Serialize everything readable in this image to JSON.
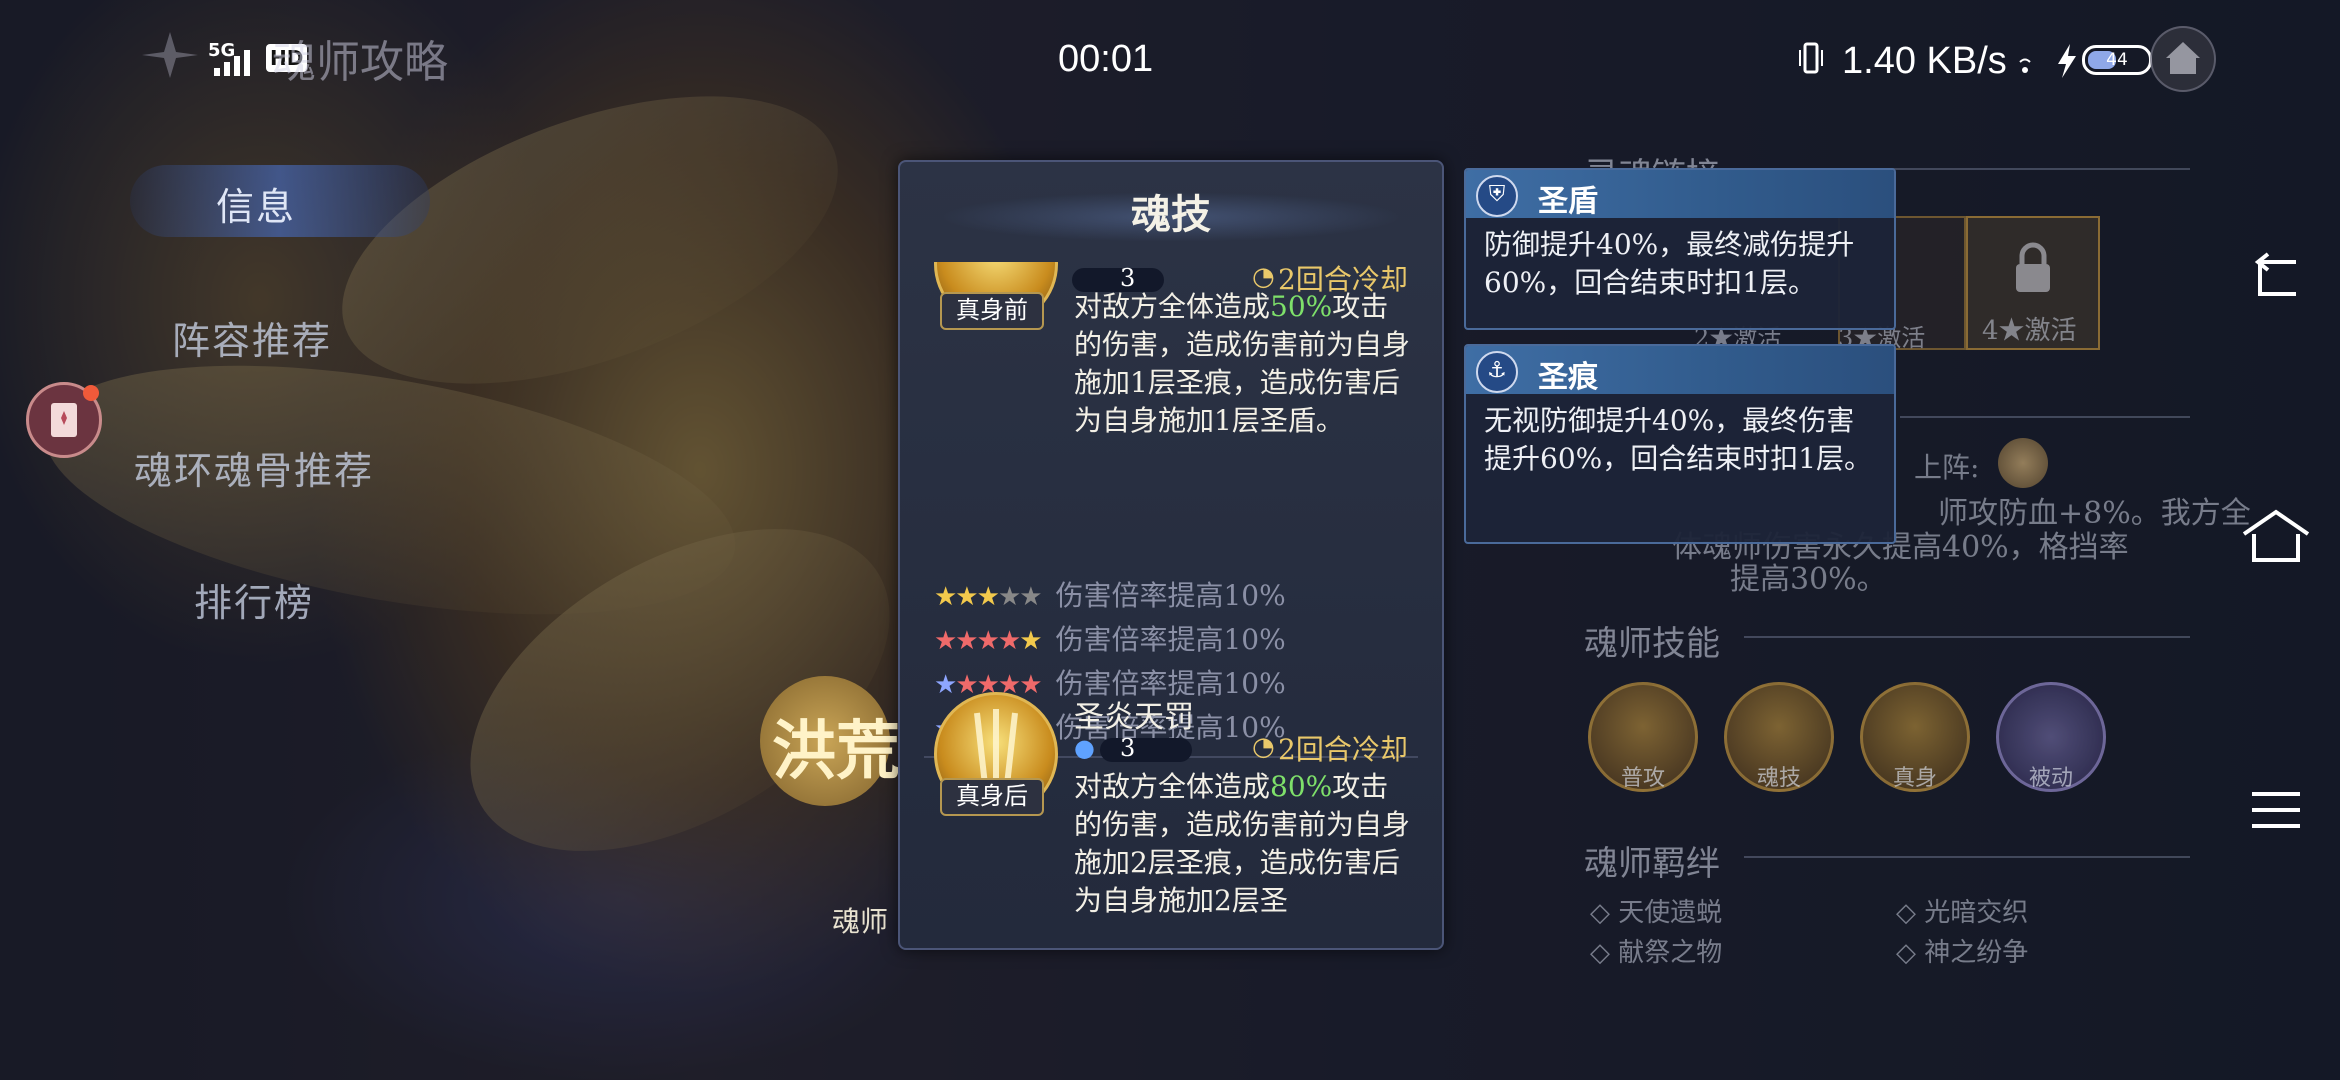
{
  "status_bar": {
    "network": "5G",
    "hd_badge": "HD",
    "time": "00:01",
    "speed": "1.40 KB/s",
    "battery": "44"
  },
  "header": {
    "title": "魂师攻略"
  },
  "left_menu": {
    "items": [
      "信息",
      "阵容推荐",
      "魂环魂骨推荐",
      "排行榜"
    ],
    "active_index": 0
  },
  "hero_banner": {
    "name_partial": "洪荒",
    "caption_partial": "魂师"
  },
  "soul_skill_panel": {
    "title": "魂技",
    "skill1": {
      "tag": "真身前",
      "cost": "3",
      "cooldown": "2回合冷却",
      "desc_before": "对敌方全体造成",
      "desc_percent": "50%",
      "desc_after": "攻击的伤害，造成伤害前为自身施加1层圣痕，造成伤害后为自身施加1层圣盾。"
    },
    "upgrades": [
      {
        "stars": "★★★★★",
        "text": "伤害倍率提高10%"
      },
      {
        "stars": "★★★★★",
        "text": "伤害倍率提高10%"
      },
      {
        "stars": "★★★★★",
        "text": "伤害倍率提高10%"
      },
      {
        "stars": "★★★★★",
        "text": "伤害倍率提高10%"
      }
    ],
    "skill2": {
      "name": "圣炎天罚",
      "tag": "真身后",
      "cost": "3",
      "cooldown": "2回合冷却",
      "desc_before": "对敌方全体造成",
      "desc_percent": "80%",
      "desc_after": "攻击的伤害，造成伤害前为自身施加2层圣痕，造成伤害后为自身施加2层圣"
    }
  },
  "tooltips": [
    {
      "title": "圣盾",
      "body": "防御提升40%，最终减伤提升60%，回合结束时扣1层。"
    },
    {
      "title": "圣痕",
      "body": "无视防御提升40%，最终伤害提升60%，回合结束时扣1层。"
    }
  ],
  "right_page": {
    "soul_chain_title": "灵魂链接",
    "activations": [
      "2★激活",
      "3★激活",
      "4★激活"
    ],
    "on_field_label": "上阵:",
    "bonus_text_1": "师攻防血+8%。我方全",
    "bonus_text_2": "体魂师伤害永久提高40%，格挡率",
    "bonus_text_3": "提高30%。",
    "skills_title": "魂师技能",
    "skills": [
      "普攻",
      "魂技",
      "真身",
      "被动"
    ],
    "bonds_title": "魂师羁绊",
    "bonds": [
      "天使遗蜕",
      "光暗交织",
      "献祭之物",
      "神之纷争"
    ]
  },
  "colors": {
    "highlight_green": "#7ee06a",
    "cooldown_gold": "#e9c86a",
    "tooltip_header": "#3f6ea5"
  }
}
